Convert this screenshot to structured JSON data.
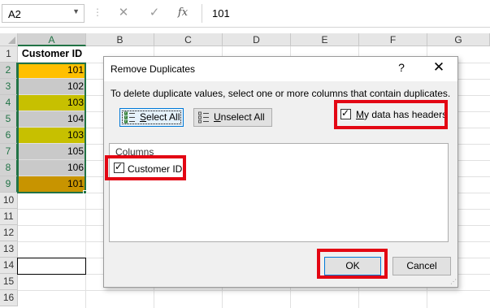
{
  "formula_bar": {
    "name_box": "A2",
    "cancel_icon": "✕",
    "enter_icon": "✓",
    "fx_label": "fx",
    "formula_value": "101"
  },
  "sheet": {
    "columns": [
      "A",
      "B",
      "C",
      "D",
      "E",
      "F",
      "G"
    ],
    "rows": [
      "1",
      "2",
      "3",
      "4",
      "5",
      "6",
      "7",
      "8",
      "9",
      "10",
      "11",
      "12",
      "13",
      "14",
      "15",
      "16"
    ],
    "column_a": [
      {
        "value": "Customer ID",
        "fill": "#ffffff"
      },
      {
        "value": "101",
        "fill": "#ffc000"
      },
      {
        "value": "102",
        "fill": "#c9c9c9"
      },
      {
        "value": "103",
        "fill": "#c7c000"
      },
      {
        "value": "104",
        "fill": "#c9c9c9"
      },
      {
        "value": "103",
        "fill": "#c7c000"
      },
      {
        "value": "105",
        "fill": "#c9c9c9"
      },
      {
        "value": "106",
        "fill": "#c9c9c9"
      },
      {
        "value": "101",
        "fill": "#c89400"
      }
    ]
  },
  "dialog": {
    "title": "Remove Duplicates",
    "help": "?",
    "close": "✕",
    "instructions": "To delete duplicate values, select one or more columns that contain duplicates.",
    "select_all": {
      "underline": "S",
      "rest": "elect All"
    },
    "unselect_all": {
      "underline": "U",
      "rest": "nselect All"
    },
    "headers_checkbox": {
      "underline": "M",
      "rest": "y data has headers",
      "checked": true
    },
    "columns_label": "Columns",
    "column_items": [
      {
        "label": "Customer ID",
        "checked": true
      }
    ],
    "ok": "OK",
    "cancel": "Cancel",
    "check_mark": "✓"
  },
  "colors": {
    "excel_green": "#217346",
    "highlight_red": "#e30613",
    "dialog_bg": "#f0f0f0"
  }
}
